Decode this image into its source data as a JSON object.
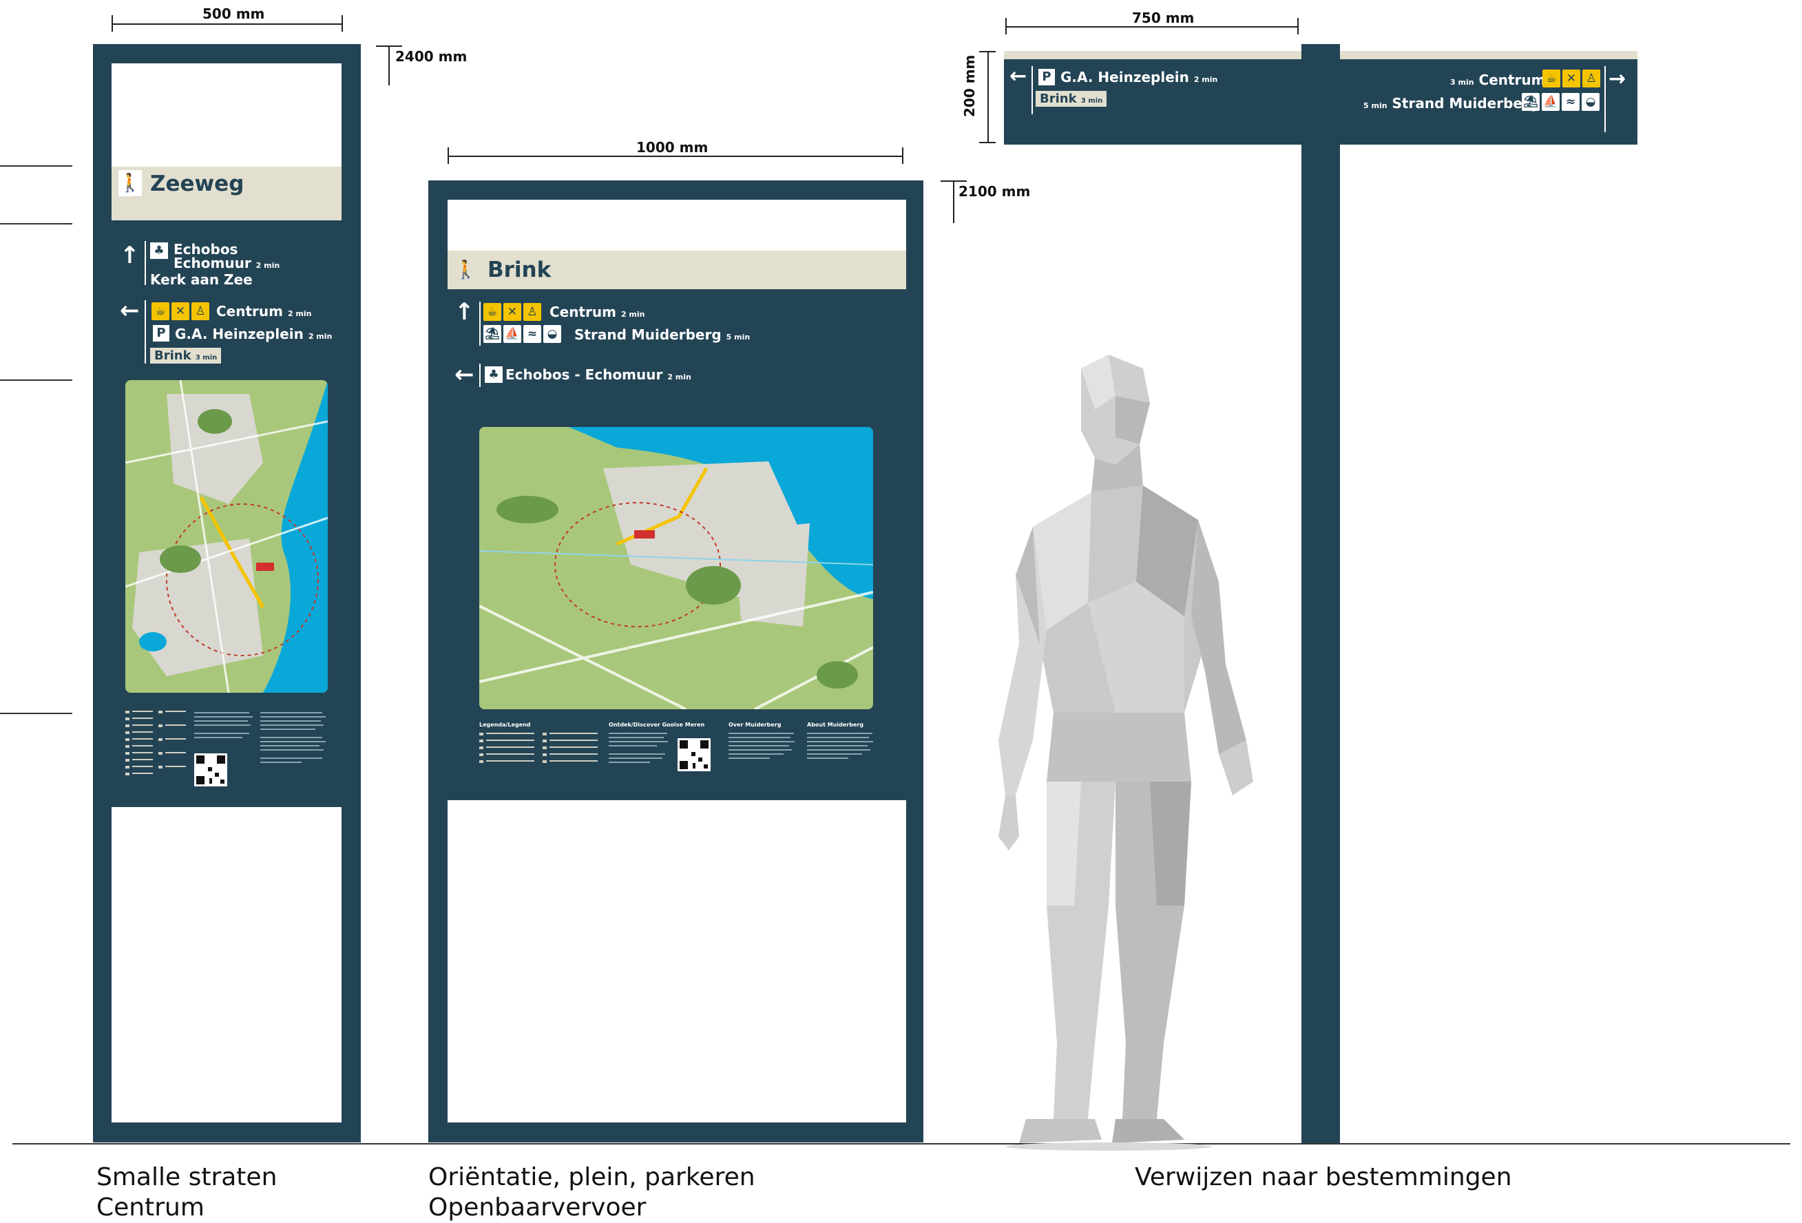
{
  "dimensions": {
    "sign1_width": "500 mm",
    "sign1_height": "2400 mm",
    "sign2_width": "1000 mm",
    "sign2_height": "2100 mm",
    "sign3_width": "750 mm",
    "sign3_height": "200 mm"
  },
  "sign1": {
    "title": "Zeeweg",
    "dest_up_1": "Echobos",
    "dest_up_2": "Echomuur",
    "dest_up_2_time": "2 min",
    "dest_up_3": "Kerk aan Zee",
    "dest_left_1": "Centrum",
    "dest_left_1_time": "2 min",
    "dest_left_2": "G.A. Heinzeplein",
    "dest_left_2_time": "2 min",
    "dest_left_3": "Brink",
    "dest_left_3_time": "3 min"
  },
  "sign2": {
    "title": "Brink",
    "dest_up_1": "Centrum",
    "dest_up_1_time": "2 min",
    "dest_up_2": "Strand Muiderberg",
    "dest_up_2_time": "5 min",
    "dest_left_1": "Echobos - Echomuur",
    "dest_left_1_time": "2 min",
    "info_headings": [
      "Legenda/Legend",
      "Ontdek/Discover Gooise Meren",
      "Over Muiderberg",
      "About Muiderberg"
    ]
  },
  "sign3": {
    "left_1": "G.A. Heinzeplein",
    "left_1_time": "2 min",
    "left_2": "Brink",
    "left_2_time": "3 min",
    "right_1": "Centrum",
    "right_1_time": "3 min",
    "right_2": "Strand Muiderberg",
    "right_2_time": "5 min"
  },
  "captions": {
    "sign1_line1": "Smalle straten",
    "sign1_line2": "Centrum",
    "sign2_line1": "Oriëntatie, plein, parkeren",
    "sign2_line2": "Openbaarvervoer",
    "sign3": "Verwijzen naar bestemmingen"
  },
  "icons": {
    "pedestrian": "pedestrian-icon",
    "tree": "tree-icon",
    "parking": "parking-icon",
    "coffee": "coffee-icon",
    "restaurant": "cutlery-icon",
    "monument": "monument-icon",
    "beach": "beach-icon",
    "sailing": "sailing-icon",
    "swim": "swim-icon"
  },
  "colors": {
    "navy": "#234455",
    "beige": "#e2dfcf",
    "yellow": "#f5c400",
    "water": "#0aa8d8",
    "land": "#a9c77a"
  }
}
